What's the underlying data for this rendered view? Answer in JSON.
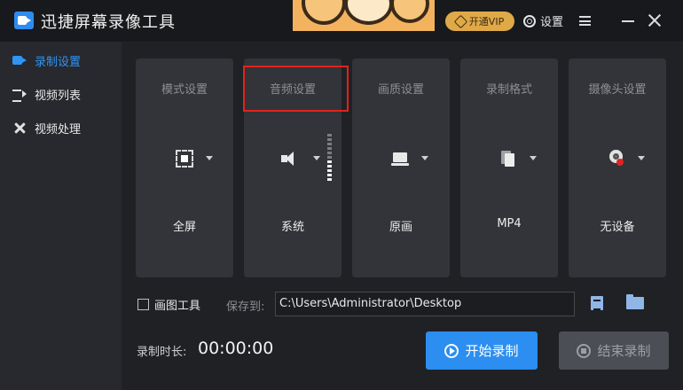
{
  "app": {
    "title": "迅捷屏幕录像工具"
  },
  "header": {
    "vip_label": "开通VIP",
    "settings_label": "设置"
  },
  "sidebar": {
    "items": [
      {
        "label": "录制设置",
        "icon": "record-icon",
        "active": true
      },
      {
        "label": "视频列表",
        "icon": "video-list-icon",
        "active": false
      },
      {
        "label": "视频处理",
        "icon": "tools-icon",
        "active": false
      }
    ]
  },
  "cards": [
    {
      "title": "模式设置",
      "value": "全屏",
      "icon": "fullscreen-icon"
    },
    {
      "title": "音频设置",
      "value": "系统",
      "icon": "speaker-icon",
      "highlighted": true
    },
    {
      "title": "画质设置",
      "value": "原画",
      "icon": "laptop-icon"
    },
    {
      "title": "录制格式",
      "value": "MP4",
      "icon": "file-icon"
    },
    {
      "title": "摄像头设置",
      "value": "无设备",
      "icon": "webcam-off-icon"
    }
  ],
  "audio": {
    "volume_level": 0.4
  },
  "draw_tool": {
    "label": "画图工具",
    "checked": false
  },
  "save": {
    "label": "保存到:",
    "path": "C:\\Users\\Administrator\\Desktop"
  },
  "duration": {
    "label": "录制时长:",
    "value": "00:00:00"
  },
  "buttons": {
    "start": "开始录制",
    "stop": "结束录制"
  },
  "colors": {
    "accent": "#2b8ef0",
    "vip": "#e0a948",
    "highlight": "#e1231d"
  }
}
